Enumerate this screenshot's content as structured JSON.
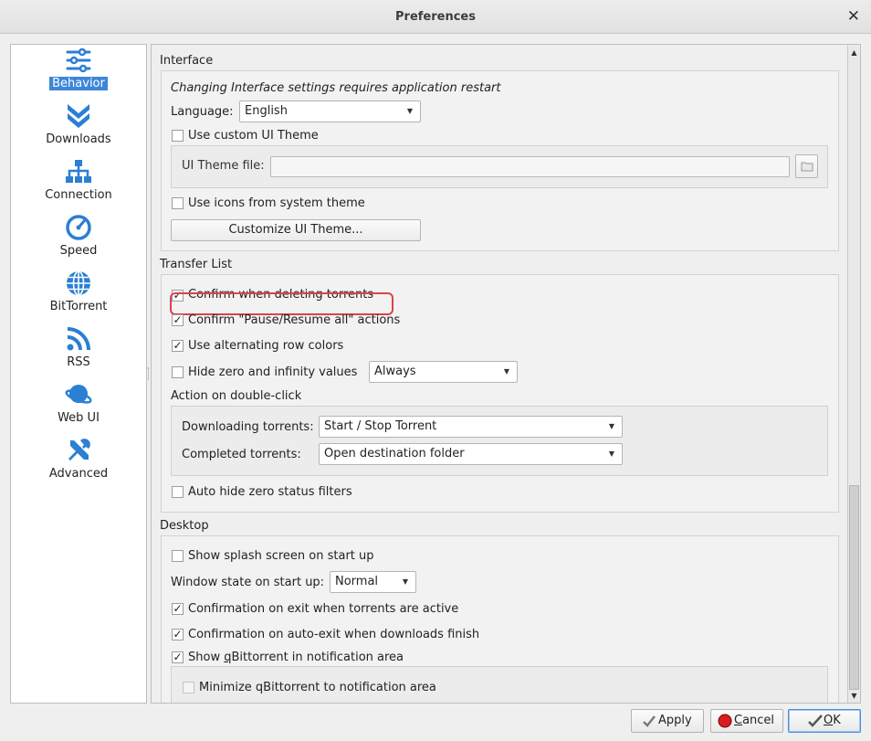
{
  "window": {
    "title": "Preferences",
    "close_glyph": "✕"
  },
  "sidebar": {
    "items": [
      {
        "label": "Behavior",
        "icon": "sliders-icon",
        "active": true
      },
      {
        "label": "Downloads",
        "icon": "double-chevron-down-icon"
      },
      {
        "label": "Connection",
        "icon": "network-icon"
      },
      {
        "label": "Speed",
        "icon": "speedometer-icon"
      },
      {
        "label": "BitTorrent",
        "icon": "globe-icon"
      },
      {
        "label": "RSS",
        "icon": "rss-icon"
      },
      {
        "label": "Web UI",
        "icon": "planet-icon"
      },
      {
        "label": "Advanced",
        "icon": "tools-icon"
      }
    ],
    "accent": "#3d86d8"
  },
  "interface": {
    "title": "Interface",
    "restart_note": "Changing Interface settings requires application restart",
    "language_label": "Language:",
    "language_value": "English",
    "custom_theme_label": "Use custom UI Theme",
    "theme_file_label": "UI Theme file:",
    "system_icons_label": "Use icons from system theme",
    "customize_button": "Customize UI Theme..."
  },
  "transfer_list": {
    "title": "Transfer List",
    "confirm_delete": "Confirm when deleting torrents",
    "confirm_pause": "Confirm \"Pause/Resume all\" actions",
    "alternating_rows": "Use alternating row colors",
    "hide_zero": "Hide zero and infinity values",
    "hide_zero_mode": "Always",
    "double_click_title": "Action on double-click",
    "downloading_label": "Downloading torrents:",
    "downloading_value": "Start / Stop Torrent",
    "completed_label": "Completed torrents:",
    "completed_value": "Open destination folder",
    "auto_hide": "Auto hide zero status filters"
  },
  "desktop": {
    "title": "Desktop",
    "splash": "Show splash screen on start up",
    "window_state_label": "Window state on start up:",
    "window_state_value": "Normal",
    "confirm_exit": "Confirmation on exit when torrents are active",
    "confirm_auto_exit": "Confirmation on auto-exit when downloads finish",
    "show_tray_pre": "Show ",
    "show_tray_u": "q",
    "show_tray_post": "Bittorrent in notification area",
    "minimize_tray": "Minimize qBittorrent to notification area"
  },
  "check_glyph": "✓",
  "buttons": {
    "apply": "Apply",
    "cancel_u": "C",
    "cancel_rest": "ancel",
    "ok_u": "O",
    "ok_rest": "K"
  },
  "colors": {
    "highlight_mark": "#d9434e"
  }
}
